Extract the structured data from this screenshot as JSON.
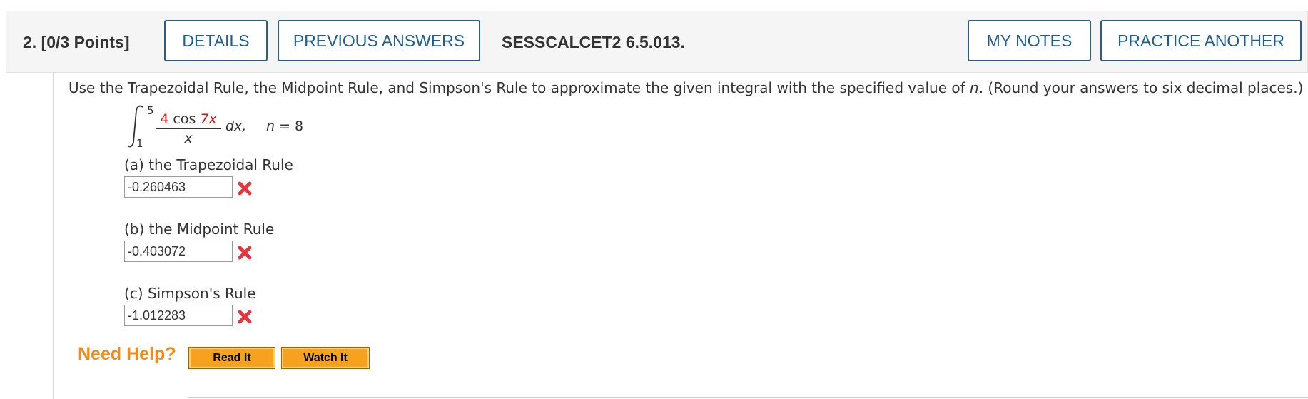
{
  "header": {
    "question_label": "2.  [0/3 Points]",
    "details_label": "DETAILS",
    "previous_answers_label": "PREVIOUS ANSWERS",
    "problem_code": "SESSCALCET2 6.5.013.",
    "my_notes_label": "MY NOTES",
    "practice_another_label": "PRACTICE ANOTHER"
  },
  "problem": {
    "instructions_part1": "Use the Trapezoidal Rule, the Midpoint Rule, and Simpson's Rule to approximate the given integral with the specified value of ",
    "instructions_var": "n",
    "instructions_part2": ". (Round your answers to six decimal places.)",
    "integral": {
      "upper_limit": "5",
      "lower_limit": "1",
      "numerator_coef": "4",
      "numerator_func": " cos ",
      "numerator_arg": "7x",
      "denominator": "x",
      "differential": "dx,",
      "n_label": "n",
      "n_value": " = 8"
    }
  },
  "parts": [
    {
      "label": "(a) the Trapezoidal Rule",
      "answer": "-0.260463",
      "status": "incorrect"
    },
    {
      "label": "(b) the Midpoint Rule",
      "answer": "-0.403072",
      "status": "incorrect"
    },
    {
      "label": "(c) Simpson's Rule",
      "answer": "-1.012283",
      "status": "incorrect"
    }
  ],
  "help": {
    "need_help_label": "Need Help?",
    "read_it_label": "Read It",
    "watch_it_label": "Watch It"
  },
  "colors": {
    "button_text": "#1f5d8c",
    "incorrect_mark": "#e8323c",
    "need_help": "#f28a1a",
    "help_button": "#f7a21f"
  }
}
